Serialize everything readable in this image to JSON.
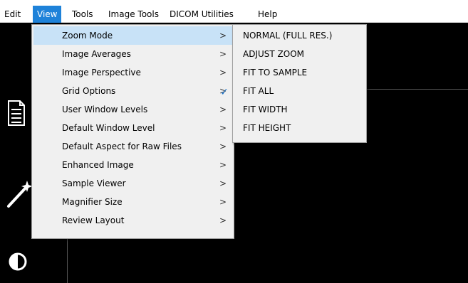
{
  "menubar": {
    "items": [
      "Edit",
      "View",
      "Tools",
      "Image Tools",
      "DICOM Utilities",
      "Help"
    ],
    "active_index": 1
  },
  "view_menu": {
    "items": [
      {
        "label": "Zoom Mode",
        "submenu": true
      },
      {
        "label": "Image Averages",
        "submenu": true
      },
      {
        "label": "Image Perspective",
        "submenu": true
      },
      {
        "label": "Grid Options",
        "submenu": true
      },
      {
        "label": "User Window Levels",
        "submenu": true
      },
      {
        "label": "Default Window Level",
        "submenu": true
      },
      {
        "label": "Default Aspect for Raw Files",
        "submenu": true
      },
      {
        "label": "Enhanced Image",
        "submenu": true
      },
      {
        "label": "Sample Viewer",
        "submenu": true
      },
      {
        "label": "Magnifier Size",
        "submenu": true
      },
      {
        "label": "Review Layout",
        "submenu": true
      }
    ],
    "highlighted_index": 0,
    "arrow_glyph": ">"
  },
  "zoom_submenu": {
    "items": [
      {
        "label": "NORMAL (FULL RES.)",
        "checked": false
      },
      {
        "label": "ADJUST ZOOM",
        "checked": false
      },
      {
        "label": "FIT TO SAMPLE",
        "checked": false
      },
      {
        "label": "FIT ALL",
        "checked": true
      },
      {
        "label": "FIT WIDTH",
        "checked": false
      },
      {
        "label": "FIT HEIGHT",
        "checked": false
      }
    ],
    "check_glyph": "✓"
  },
  "colors": {
    "accent": "#1e82d9",
    "highlight": "#c8e2f7",
    "menu_bg": "#f0f0f0",
    "canvas_bg": "#000000"
  },
  "toolbar_icons": [
    "document-icon",
    "magic-wand-icon",
    "contrast-icon"
  ]
}
